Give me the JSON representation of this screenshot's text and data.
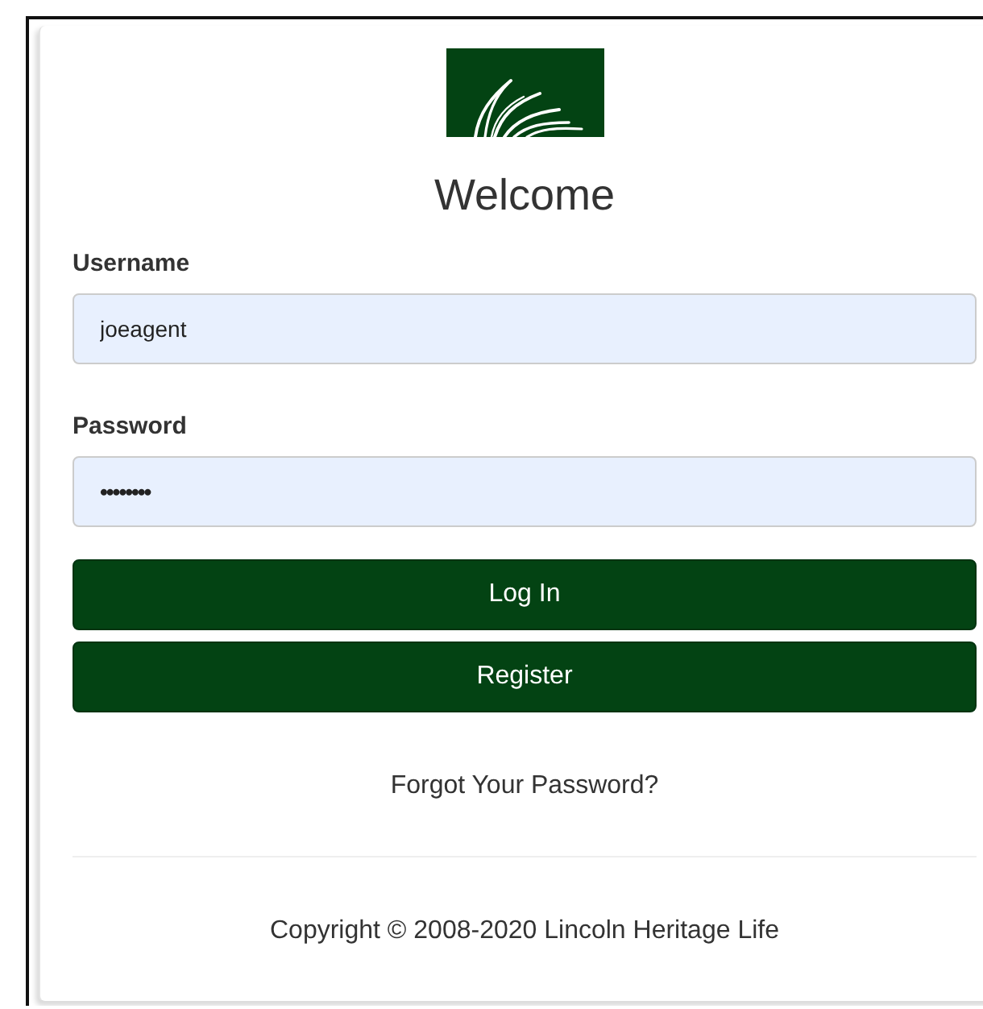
{
  "title": "Welcome",
  "fields": [
    {
      "label": "Username",
      "value": "joeagent"
    },
    {
      "label": "Password",
      "value": "••••••••"
    }
  ],
  "buttons": [
    "Log In",
    "Register"
  ],
  "forgot_link": "Forgot Your Password?",
  "copyright": "Copyright © 2008-2020 Lincoln Heritage Life"
}
